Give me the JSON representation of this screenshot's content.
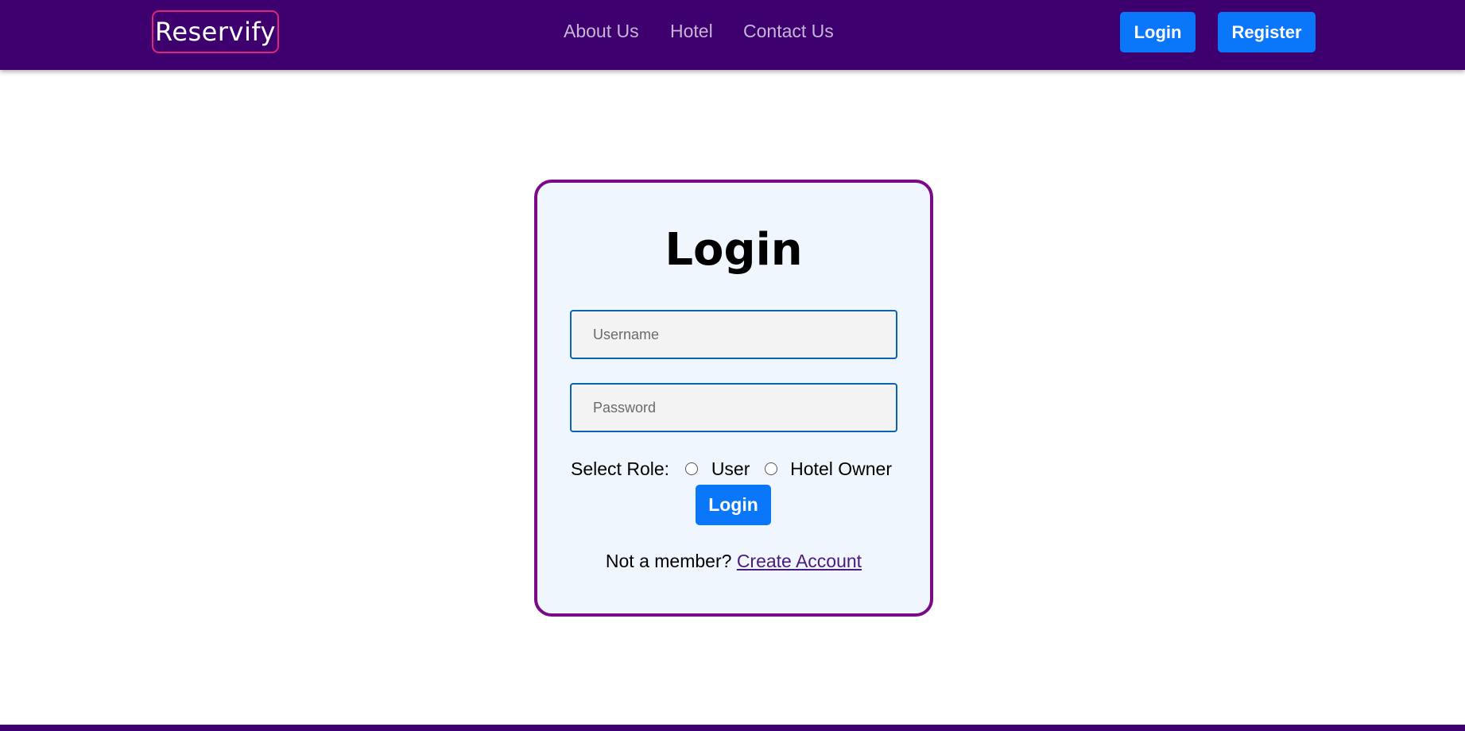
{
  "header": {
    "brand": "Reservify",
    "nav": [
      "About Us",
      "Hotel",
      "Contact Us"
    ],
    "login_label": "Login",
    "register_label": "Register"
  },
  "login_form": {
    "title": "Login",
    "username_placeholder": "Username",
    "password_placeholder": "Password",
    "role_label": "Select Role:",
    "roles": [
      "User",
      "Hotel Owner"
    ],
    "submit_label": "Login",
    "signup_prompt": "Not a member?",
    "signup_link": "Create Account"
  },
  "colors": {
    "navbar": "#3f006f",
    "brand_border": "#e0257a",
    "button": "#0a77fb",
    "card_border": "#7a0a87",
    "card_bg": "#eff6fd",
    "input_border": "#0a63b5",
    "link": "#4b1b7e"
  }
}
